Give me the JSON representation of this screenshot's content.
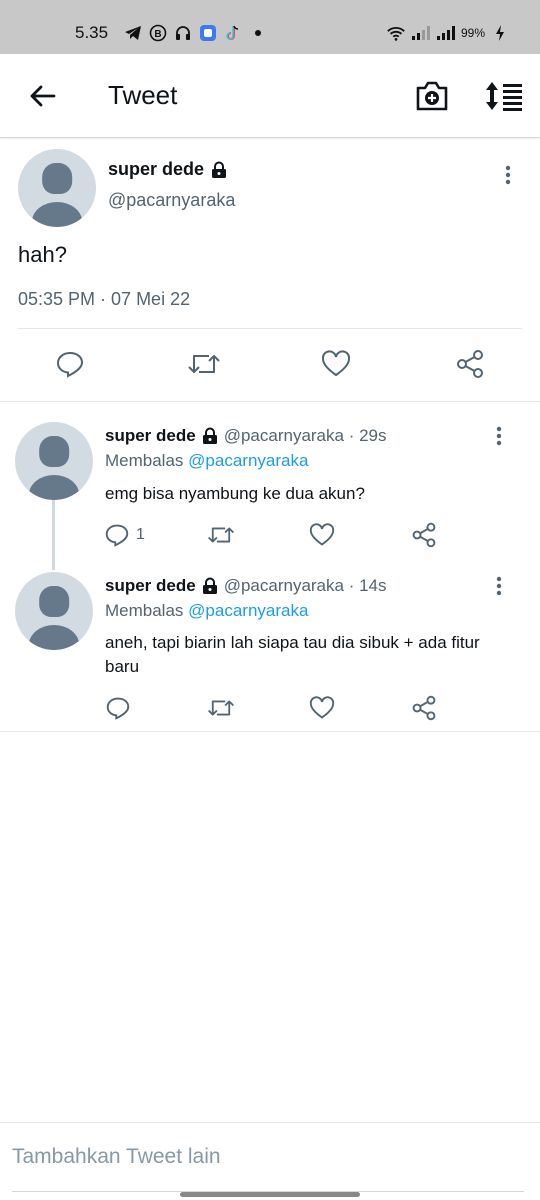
{
  "status_bar": {
    "time": "5.35",
    "battery": "99%",
    "icons_left": [
      "telegram-icon",
      "b-icon",
      "headphones-icon",
      "app-icon",
      "tiktok-icon",
      "dot-icon"
    ],
    "icons_right": [
      "wifi-icon",
      "signal-icon",
      "signal-icon",
      "charging-icon"
    ]
  },
  "header": {
    "title": "Tweet",
    "icons": [
      "back-arrow-icon",
      "camera-add-icon",
      "sort-icon"
    ]
  },
  "main_tweet": {
    "name": "super dede",
    "handle": "@pacarnyaraka",
    "text": "hah?",
    "timestamp": "05:35 PM · 07 Mei 22",
    "actions": [
      "reply-icon",
      "retweet-icon",
      "like-icon",
      "share-icon"
    ]
  },
  "replies": [
    {
      "name": "super dede",
      "handle": "@pacarnyaraka · 29s",
      "replying_label": "Membalas",
      "replying_to": "@pacarnyaraka",
      "text": "emg bisa nyambung ke dua akun?",
      "reply_count": "1"
    },
    {
      "name": "super dede",
      "handle": "@pacarnyaraka · 14s",
      "replying_label": "Membalas",
      "replying_to": "@pacarnyaraka",
      "text": "aneh, tapi biarin lah siapa tau dia sibuk + ada fitur baru",
      "reply_count": ""
    }
  ],
  "composer": {
    "placeholder": "Tambahkan Tweet lain"
  },
  "colors": {
    "accent": "#1d9bf0",
    "secondary_text": "#536471",
    "avatar_bg": "#d3dbe2",
    "avatar_fg": "#65798a"
  }
}
